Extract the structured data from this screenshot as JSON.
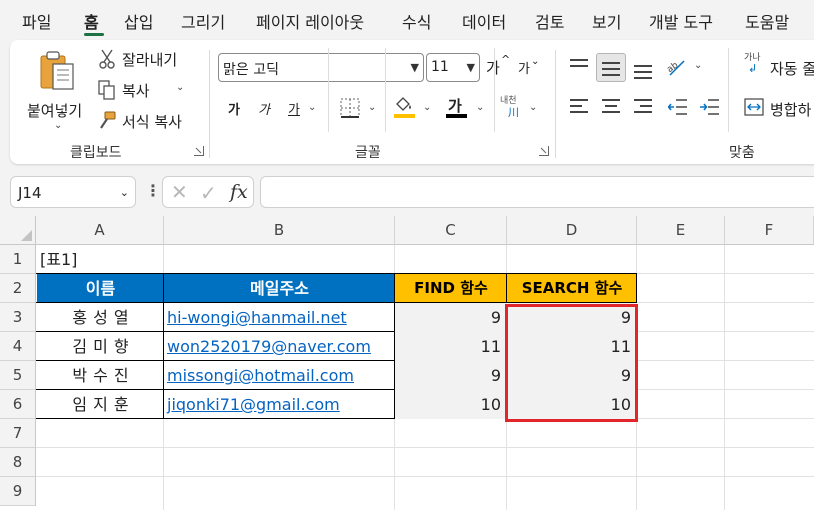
{
  "menu": {
    "tabs": [
      "파일",
      "홈",
      "삽입",
      "그리기",
      "페이지 레이아웃",
      "수식",
      "데이터",
      "검토",
      "보기",
      "개발 도구",
      "도움말"
    ],
    "active": "홈"
  },
  "ribbon": {
    "clipboard": {
      "paste_label": "붙여넣기",
      "cut_label": "잘라내기",
      "copy_label": "복사",
      "format_painter_label": "서식 복사",
      "group_label": "클립보드"
    },
    "font": {
      "font_name": "맑은 고딕",
      "font_size": "11",
      "bold_glyph": "가",
      "italic_glyph": "가",
      "underline_glyph": "가",
      "grow_glyph": "가",
      "shrink_glyph": "가",
      "color_glyph": "가",
      "phonetic_glyph": "내천",
      "group_label": "글꼴",
      "fill_color": "#ffc000",
      "font_color": "#000000"
    },
    "alignment": {
      "wrap_text_label": "자동 줄",
      "merge_label": "병합하",
      "wrap_icon_text": "가나",
      "group_label": "맞춤"
    }
  },
  "formula_bar": {
    "name_box": "J14",
    "fx_label": "fx",
    "formula": ""
  },
  "sheet": {
    "columns": [
      "A",
      "B",
      "C",
      "D",
      "E",
      "F"
    ],
    "rows": [
      "1",
      "2",
      "3",
      "4",
      "5",
      "6",
      "7",
      "8",
      "9"
    ],
    "title": "[표1]",
    "headers": [
      "이름",
      "메일주소",
      "FIND 함수",
      "SEARCH 함수"
    ],
    "records": [
      {
        "name": "홍성열",
        "email": "hi-wongi@hanmail.net",
        "find": "9",
        "search": "9"
      },
      {
        "name": "김미향",
        "email": "won2520179@naver.com",
        "find": "11",
        "search": "11"
      },
      {
        "name": "박수진",
        "email": "missongi@hotmail.com",
        "find": "9",
        "search": "9"
      },
      {
        "name": "임지훈",
        "email": "jiqonki71@gmail.com",
        "find": "10",
        "search": "10"
      }
    ],
    "colors": {
      "header_blue": "#0070c0",
      "header_gold": "#ffc000",
      "highlight_red": "#e0262b",
      "link_blue": "#0563c1"
    }
  }
}
